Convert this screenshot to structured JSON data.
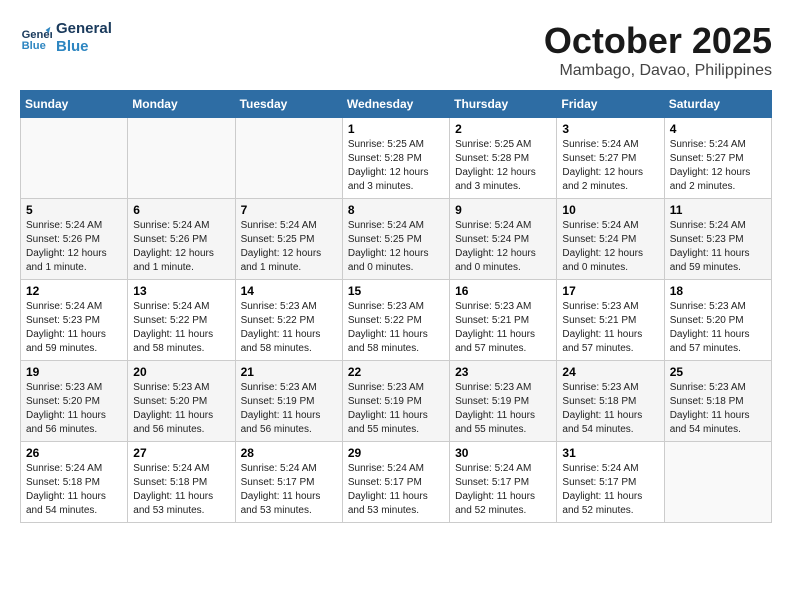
{
  "header": {
    "logo_line1": "General",
    "logo_line2": "Blue",
    "month": "October 2025",
    "location": "Mambago, Davao, Philippines"
  },
  "weekdays": [
    "Sunday",
    "Monday",
    "Tuesday",
    "Wednesday",
    "Thursday",
    "Friday",
    "Saturday"
  ],
  "weeks": [
    [
      {
        "day": "",
        "content": ""
      },
      {
        "day": "",
        "content": ""
      },
      {
        "day": "",
        "content": ""
      },
      {
        "day": "1",
        "content": "Sunrise: 5:25 AM\nSunset: 5:28 PM\nDaylight: 12 hours and 3 minutes."
      },
      {
        "day": "2",
        "content": "Sunrise: 5:25 AM\nSunset: 5:28 PM\nDaylight: 12 hours and 3 minutes."
      },
      {
        "day": "3",
        "content": "Sunrise: 5:24 AM\nSunset: 5:27 PM\nDaylight: 12 hours and 2 minutes."
      },
      {
        "day": "4",
        "content": "Sunrise: 5:24 AM\nSunset: 5:27 PM\nDaylight: 12 hours and 2 minutes."
      }
    ],
    [
      {
        "day": "5",
        "content": "Sunrise: 5:24 AM\nSunset: 5:26 PM\nDaylight: 12 hours and 1 minute."
      },
      {
        "day": "6",
        "content": "Sunrise: 5:24 AM\nSunset: 5:26 PM\nDaylight: 12 hours and 1 minute."
      },
      {
        "day": "7",
        "content": "Sunrise: 5:24 AM\nSunset: 5:25 PM\nDaylight: 12 hours and 1 minute."
      },
      {
        "day": "8",
        "content": "Sunrise: 5:24 AM\nSunset: 5:25 PM\nDaylight: 12 hours and 0 minutes."
      },
      {
        "day": "9",
        "content": "Sunrise: 5:24 AM\nSunset: 5:24 PM\nDaylight: 12 hours and 0 minutes."
      },
      {
        "day": "10",
        "content": "Sunrise: 5:24 AM\nSunset: 5:24 PM\nDaylight: 12 hours and 0 minutes."
      },
      {
        "day": "11",
        "content": "Sunrise: 5:24 AM\nSunset: 5:23 PM\nDaylight: 11 hours and 59 minutes."
      }
    ],
    [
      {
        "day": "12",
        "content": "Sunrise: 5:24 AM\nSunset: 5:23 PM\nDaylight: 11 hours and 59 minutes."
      },
      {
        "day": "13",
        "content": "Sunrise: 5:24 AM\nSunset: 5:22 PM\nDaylight: 11 hours and 58 minutes."
      },
      {
        "day": "14",
        "content": "Sunrise: 5:23 AM\nSunset: 5:22 PM\nDaylight: 11 hours and 58 minutes."
      },
      {
        "day": "15",
        "content": "Sunrise: 5:23 AM\nSunset: 5:22 PM\nDaylight: 11 hours and 58 minutes."
      },
      {
        "day": "16",
        "content": "Sunrise: 5:23 AM\nSunset: 5:21 PM\nDaylight: 11 hours and 57 minutes."
      },
      {
        "day": "17",
        "content": "Sunrise: 5:23 AM\nSunset: 5:21 PM\nDaylight: 11 hours and 57 minutes."
      },
      {
        "day": "18",
        "content": "Sunrise: 5:23 AM\nSunset: 5:20 PM\nDaylight: 11 hours and 57 minutes."
      }
    ],
    [
      {
        "day": "19",
        "content": "Sunrise: 5:23 AM\nSunset: 5:20 PM\nDaylight: 11 hours and 56 minutes."
      },
      {
        "day": "20",
        "content": "Sunrise: 5:23 AM\nSunset: 5:20 PM\nDaylight: 11 hours and 56 minutes."
      },
      {
        "day": "21",
        "content": "Sunrise: 5:23 AM\nSunset: 5:19 PM\nDaylight: 11 hours and 56 minutes."
      },
      {
        "day": "22",
        "content": "Sunrise: 5:23 AM\nSunset: 5:19 PM\nDaylight: 11 hours and 55 minutes."
      },
      {
        "day": "23",
        "content": "Sunrise: 5:23 AM\nSunset: 5:19 PM\nDaylight: 11 hours and 55 minutes."
      },
      {
        "day": "24",
        "content": "Sunrise: 5:23 AM\nSunset: 5:18 PM\nDaylight: 11 hours and 54 minutes."
      },
      {
        "day": "25",
        "content": "Sunrise: 5:23 AM\nSunset: 5:18 PM\nDaylight: 11 hours and 54 minutes."
      }
    ],
    [
      {
        "day": "26",
        "content": "Sunrise: 5:24 AM\nSunset: 5:18 PM\nDaylight: 11 hours and 54 minutes."
      },
      {
        "day": "27",
        "content": "Sunrise: 5:24 AM\nSunset: 5:18 PM\nDaylight: 11 hours and 53 minutes."
      },
      {
        "day": "28",
        "content": "Sunrise: 5:24 AM\nSunset: 5:17 PM\nDaylight: 11 hours and 53 minutes."
      },
      {
        "day": "29",
        "content": "Sunrise: 5:24 AM\nSunset: 5:17 PM\nDaylight: 11 hours and 53 minutes."
      },
      {
        "day": "30",
        "content": "Sunrise: 5:24 AM\nSunset: 5:17 PM\nDaylight: 11 hours and 52 minutes."
      },
      {
        "day": "31",
        "content": "Sunrise: 5:24 AM\nSunset: 5:17 PM\nDaylight: 11 hours and 52 minutes."
      },
      {
        "day": "",
        "content": ""
      }
    ]
  ]
}
